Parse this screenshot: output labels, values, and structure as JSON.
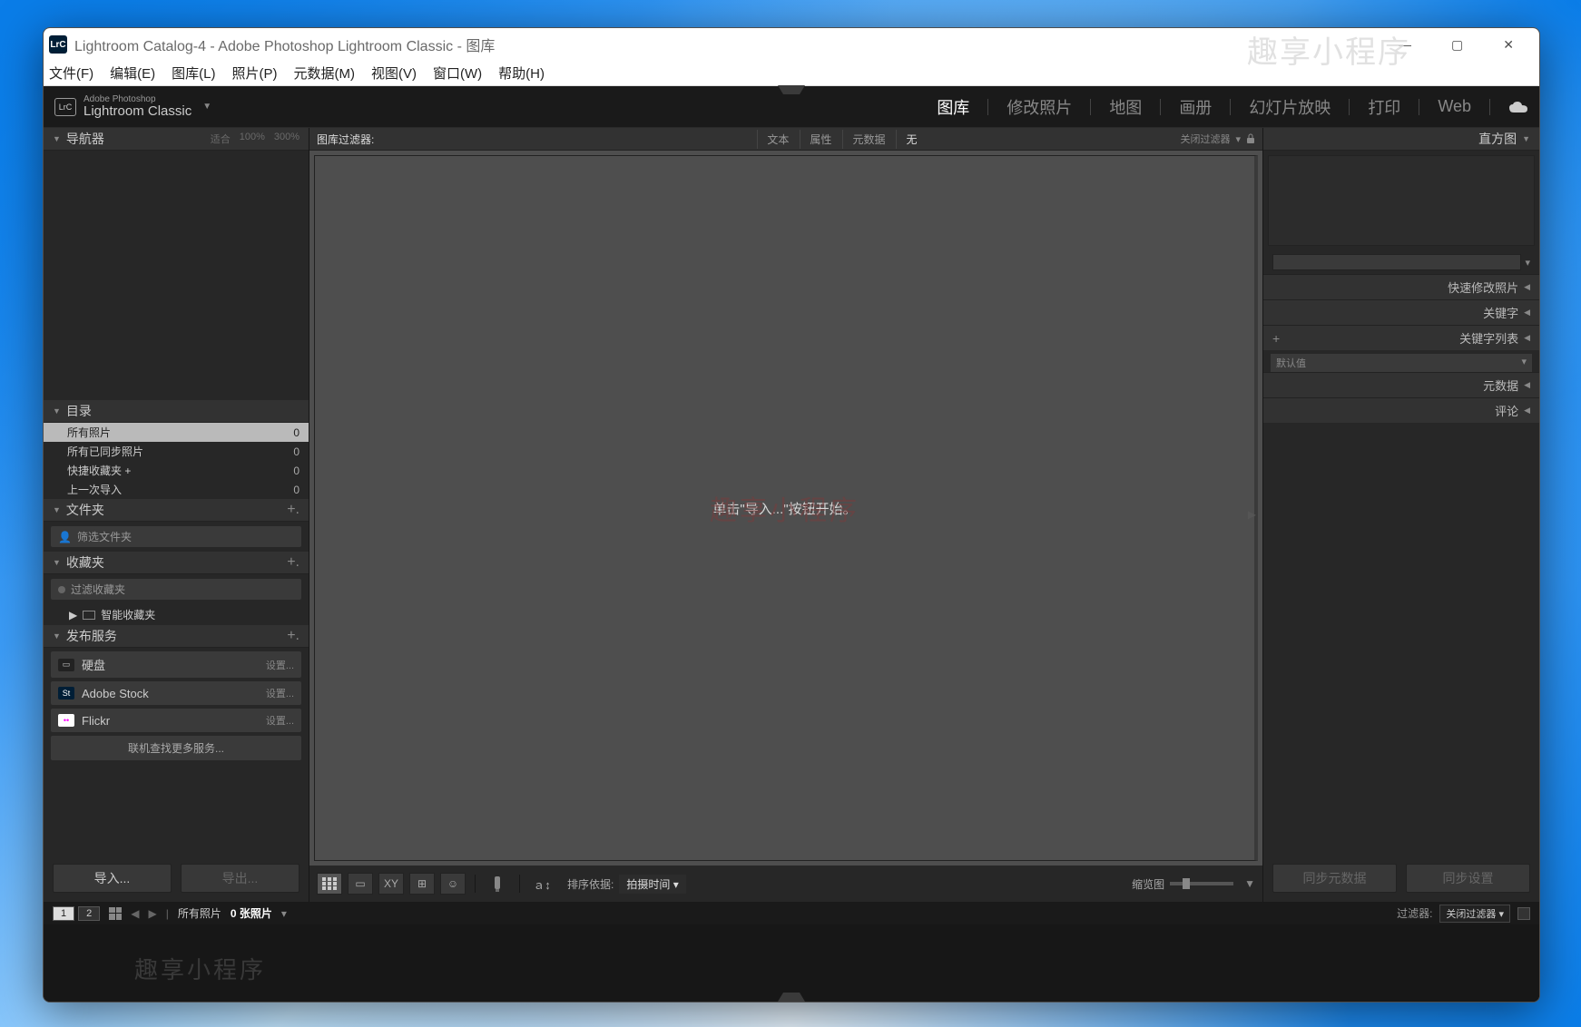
{
  "window": {
    "title": "Lightroom Catalog-4 - Adobe Photoshop Lightroom Classic - 图库",
    "app_icon_text": "LrC"
  },
  "watermark": "趣享小程序",
  "menubar": [
    "文件(F)",
    "编辑(E)",
    "图库(L)",
    "照片(P)",
    "元数据(M)",
    "视图(V)",
    "窗口(W)",
    "帮助(H)"
  ],
  "brand": {
    "line1": "Adobe Photoshop",
    "line2": "Lightroom Classic"
  },
  "modules": [
    {
      "label": "图库",
      "active": true
    },
    {
      "label": "修改照片",
      "active": false
    },
    {
      "label": "地图",
      "active": false
    },
    {
      "label": "画册",
      "active": false
    },
    {
      "label": "幻灯片放映",
      "active": false
    },
    {
      "label": "打印",
      "active": false
    },
    {
      "label": "Web",
      "active": false
    }
  ],
  "left": {
    "navigator": {
      "title": "导航器",
      "fit": "适合",
      "p100": "100%",
      "p300": "300%"
    },
    "catalog": {
      "title": "目录",
      "items": [
        {
          "label": "所有照片",
          "count": "0",
          "selected": true
        },
        {
          "label": "所有已同步照片",
          "count": "0",
          "selected": false
        },
        {
          "label": "快捷收藏夹  +",
          "count": "0",
          "selected": false
        },
        {
          "label": "上一次导入",
          "count": "0",
          "selected": false
        }
      ]
    },
    "folders": {
      "title": "文件夹",
      "filter_placeholder": "筛选文件夹"
    },
    "collections": {
      "title": "收藏夹",
      "filter_placeholder": "过滤收藏夹",
      "smart_label": "智能收藏夹"
    },
    "publish": {
      "title": "发布服务",
      "services": [
        {
          "name": "硬盘",
          "setup": "设置...",
          "icon": "▭"
        },
        {
          "name": "Adobe Stock",
          "setup": "设置...",
          "icon": "St"
        },
        {
          "name": "Flickr",
          "setup": "设置...",
          "icon": "••"
        }
      ],
      "more": "联机查找更多服务..."
    },
    "import_label": "导入...",
    "export_label": "导出..."
  },
  "center": {
    "filter_label": "图库过滤器:",
    "tabs": [
      {
        "label": "文本"
      },
      {
        "label": "属性"
      },
      {
        "label": "元数据"
      },
      {
        "label": "无"
      }
    ],
    "filter_off": "关闭过滤器",
    "empty_msg": "单击\"导入...\"按钮开始。",
    "toolbar": {
      "sort_label": "排序依据:",
      "sort_value": "拍摄时间",
      "thumb_label": "缩览图"
    }
  },
  "right": {
    "histogram": "直方图",
    "quick": "快速修改照片",
    "keywords": "关键字",
    "keyword_list": "关键字列表",
    "metadata": "元数据",
    "comments": "评论",
    "default_set": "默认值",
    "sync_meta": "同步元数据",
    "sync_settings": "同步设置"
  },
  "filmstrip": {
    "all_photos": "所有照片",
    "count_text": "0 张照片",
    "filter_label": "过滤器:",
    "filter_value": "关闭过滤器"
  }
}
